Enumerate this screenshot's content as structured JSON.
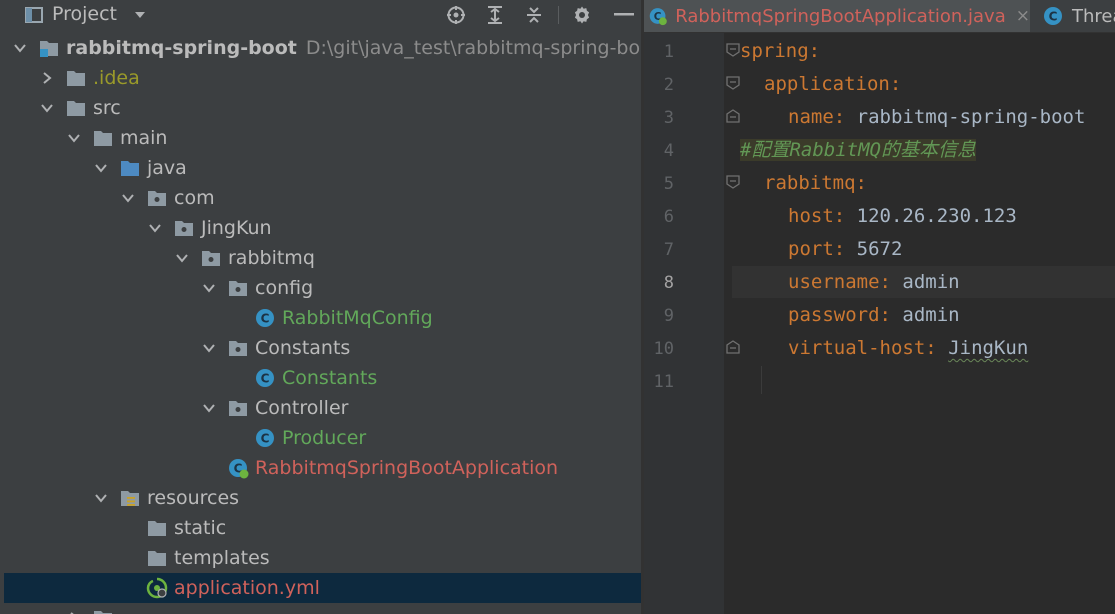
{
  "project_panel": {
    "title": "Project",
    "tree": [
      {
        "label": "rabbitmq-spring-boot",
        "path": "D:\\git\\java_test\\rabbitmq-spring-boot",
        "kind": "module",
        "expanded": true,
        "depth": 0
      },
      {
        "label": ".idea",
        "kind": "folder",
        "expanded": false,
        "depth": 1
      },
      {
        "label": "src",
        "kind": "folder",
        "expanded": true,
        "depth": 1
      },
      {
        "label": "main",
        "kind": "folder",
        "expanded": true,
        "depth": 2
      },
      {
        "label": "java",
        "kind": "source-root",
        "expanded": true,
        "depth": 3
      },
      {
        "label": "com",
        "kind": "package",
        "expanded": true,
        "depth": 4
      },
      {
        "label": "JingKun",
        "kind": "package",
        "expanded": true,
        "depth": 5
      },
      {
        "label": "rabbitmq",
        "kind": "package",
        "expanded": true,
        "depth": 6
      },
      {
        "label": "config",
        "kind": "package",
        "expanded": true,
        "depth": 7
      },
      {
        "label": "RabbitMqConfig",
        "kind": "class",
        "depth": 8
      },
      {
        "label": "Constants",
        "kind": "package",
        "expanded": true,
        "depth": 7
      },
      {
        "label": "Constants",
        "kind": "class",
        "depth": 8
      },
      {
        "label": "Controller",
        "kind": "package",
        "expanded": true,
        "depth": 7
      },
      {
        "label": "Producer",
        "kind": "class",
        "depth": 8
      },
      {
        "label": "RabbitmqSpringBootApplication",
        "kind": "spring-class",
        "depth": 7
      },
      {
        "label": "resources",
        "kind": "resources",
        "expanded": true,
        "depth": 3
      },
      {
        "label": "static",
        "kind": "folder",
        "depth": 4
      },
      {
        "label": "templates",
        "kind": "folder",
        "depth": 4
      },
      {
        "label": "application.yml",
        "kind": "yaml",
        "depth": 4,
        "selected": true
      }
    ]
  },
  "editor": {
    "tabs": [
      {
        "label": "RabbitmqSpringBootApplication.java",
        "active": true,
        "close": "×"
      },
      {
        "label": "Threa"
      }
    ],
    "lines": [
      {
        "n": "1",
        "text": ""
      },
      {
        "n": "2",
        "text": ""
      },
      {
        "n": "3",
        "text": ""
      },
      {
        "n": "4",
        "text": ""
      },
      {
        "n": "5",
        "text": ""
      },
      {
        "n": "6",
        "text": ""
      },
      {
        "n": "7",
        "text": ""
      },
      {
        "n": "8",
        "text": ""
      },
      {
        "n": "9",
        "text": ""
      },
      {
        "n": "10",
        "text": ""
      },
      {
        "n": "11",
        "text": ""
      }
    ],
    "code": {
      "l1_key": "spring",
      "l1_colon": ":",
      "l2_key": "application",
      "l2_colon": ":",
      "l3_key": "name",
      "l3_colon": ":",
      "l3_val": " rabbitmq-spring-boot",
      "l4_comment": "#配置RabbitMQ的基本信息",
      "l5_key": "rabbitmq",
      "l5_colon": ":",
      "l6_key": "host",
      "l6_colon": ":",
      "l6_val": " 120.26.230.123",
      "l7_key": "port",
      "l7_colon": ":",
      "l7_val": " 5672",
      "l8_key": "username",
      "l8_colon": ":",
      "l8_val": " admin",
      "l9_key": "password",
      "l9_colon": ":",
      "l9_val": " admin",
      "l10_key": "virtual-host",
      "l10_colon": ":",
      "l10_val": "JingKun"
    },
    "current_line": "8"
  },
  "colors": {
    "panel_bg": "#3c3f41",
    "editor_bg": "#2b2b2b",
    "selection": "#0d293e",
    "yaml_key": "#cc7832",
    "comment": "#629755",
    "class_green": "#62a85a",
    "modified_red": "#d0625b"
  }
}
